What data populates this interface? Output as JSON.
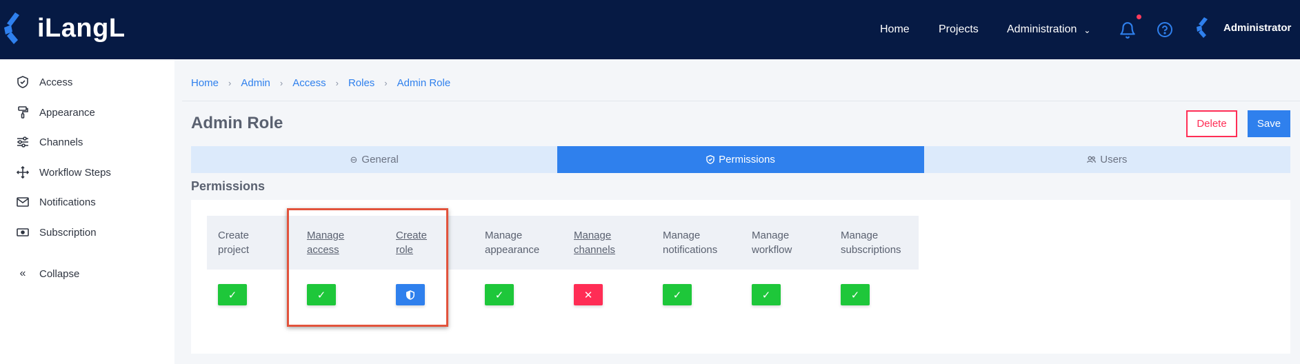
{
  "app": {
    "logo_text": "iLangL"
  },
  "topnav": {
    "items": [
      "Home",
      "Projects",
      "Administration"
    ],
    "icons": [
      "bell-icon",
      "help-icon"
    ],
    "user": "Administrator"
  },
  "sidebar": {
    "items": [
      {
        "label": "Access",
        "icon": "shield-icon"
      },
      {
        "label": "Appearance",
        "icon": "paint-roller-icon"
      },
      {
        "label": "Channels",
        "icon": "sliders-icon"
      },
      {
        "label": "Workflow Steps",
        "icon": "workflow-icon"
      },
      {
        "label": "Notifications",
        "icon": "mail-icon"
      },
      {
        "label": "Subscription",
        "icon": "card-icon"
      }
    ],
    "collapse_label": "Collapse"
  },
  "breadcrumb": [
    "Home",
    "Admin",
    "Access",
    "Roles",
    "Admin Role"
  ],
  "page": {
    "title": "Admin Role",
    "delete_label": "Delete",
    "save_label": "Save"
  },
  "tabs": [
    {
      "label": "General",
      "icon": "minus-circle-icon",
      "active": false
    },
    {
      "label": "Permissions",
      "icon": "shield-check-icon",
      "active": true
    },
    {
      "label": "Users",
      "icon": "users-icon",
      "active": false
    }
  ],
  "permissions": {
    "section_title": "Permissions",
    "columns": [
      {
        "line1": "Create",
        "line2": "project",
        "link": false,
        "state": "granted",
        "glyph": "✓"
      },
      {
        "line1": "Manage",
        "line2": "access",
        "link": true,
        "state": "granted",
        "glyph": "✓"
      },
      {
        "line1": "Create",
        "line2": "role",
        "link": true,
        "state": "inherited",
        "glyph": "⛊"
      },
      {
        "line1": "Manage",
        "line2": "appearance",
        "link": false,
        "state": "granted",
        "glyph": "✓"
      },
      {
        "line1": "Manage",
        "line2": "channels",
        "link": true,
        "state": "denied",
        "glyph": "✕"
      },
      {
        "line1": "Manage",
        "line2": "notifications",
        "link": false,
        "state": "granted",
        "glyph": "✓"
      },
      {
        "line1": "Manage",
        "line2": "workflow",
        "link": false,
        "state": "granted",
        "glyph": "✓"
      },
      {
        "line1": "Manage",
        "line2": "subscriptions",
        "link": false,
        "state": "granted",
        "glyph": "✓"
      }
    ]
  },
  "colors": {
    "navbar": "#061a44",
    "accent": "#2f80ed",
    "granted": "#1ec73a",
    "denied": "#ff2d55",
    "highlight": "#e2533c"
  }
}
